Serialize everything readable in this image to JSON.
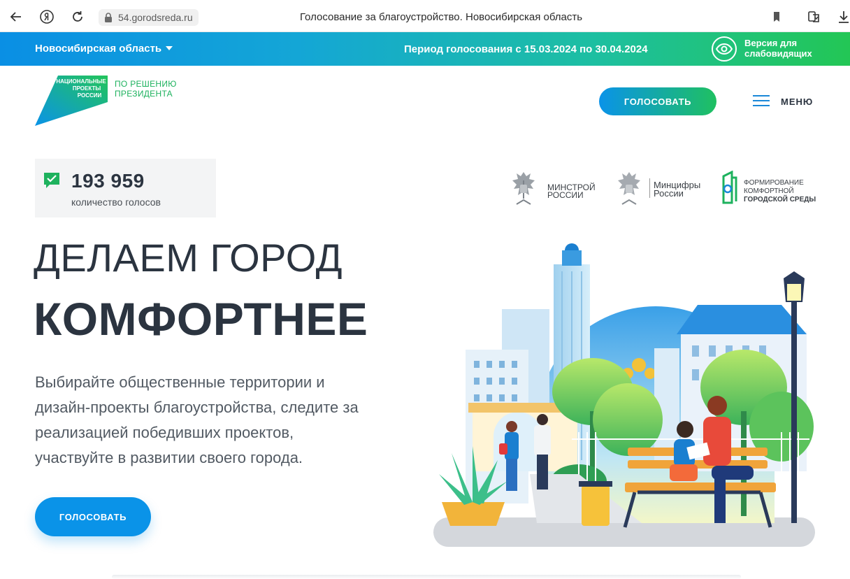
{
  "browser": {
    "url": "54.gorodsreda.ru",
    "tab_title": "Голосование за благоустройство. Новосибирская область",
    "icons": [
      "back-arrow-icon",
      "yandex-icon",
      "reload-icon",
      "lock-icon",
      "bookmark-icon",
      "reader-icon",
      "download-icon"
    ]
  },
  "topbar": {
    "region": "Новосибирская область",
    "period": "Период голосования с 15.03.2024 по 30.04.2024",
    "vision_line1": "Версия для",
    "vision_line2": "слабовидящих"
  },
  "header": {
    "logo_line1": "НАЦИОНАЛЬНЫЕ",
    "logo_line2": "ПРОЕКТЫ",
    "logo_line3": "РОССИИ",
    "caption_line1": "ПО РЕШЕНИЮ",
    "caption_line2": "ПРЕЗИДЕНТА",
    "vote_button": "ГОЛОСОВАТЬ",
    "menu_label": "МЕНЮ"
  },
  "counter": {
    "value": "193 959",
    "label": "количество голосов"
  },
  "partners": {
    "minstroy_line1": "МИНСТРОЙ",
    "minstroy_line2": "РОССИИ",
    "mintsifry_line1": "Минцифры",
    "mintsifry_line2": "России",
    "fks_line1": "ФОРМИРОВАНИЕ",
    "fks_line2": "КОМФОРТНОЙ",
    "fks_line3": "ГОРОДСКОЙ СРЕДЫ"
  },
  "hero": {
    "line1": "ДЕЛАЕМ ГОРОД",
    "line2": "КОМФОРТНЕЕ",
    "desc_line1": "Выбирайте общественные территории и",
    "desc_line2": "дизайн-проекты благоустройства, следите за",
    "desc_line3": "реализацией победивших проектов,",
    "desc_line4": "участвуйте в развитии своего города.",
    "vote_button": "ГОЛОСОВАТЬ"
  },
  "colors": {
    "gradient_start": "#0a8fe4",
    "gradient_end": "#23c655",
    "brand_green": "#1eb25e",
    "brand_blue": "#0a93e8",
    "text_dark": "#2b3440"
  }
}
